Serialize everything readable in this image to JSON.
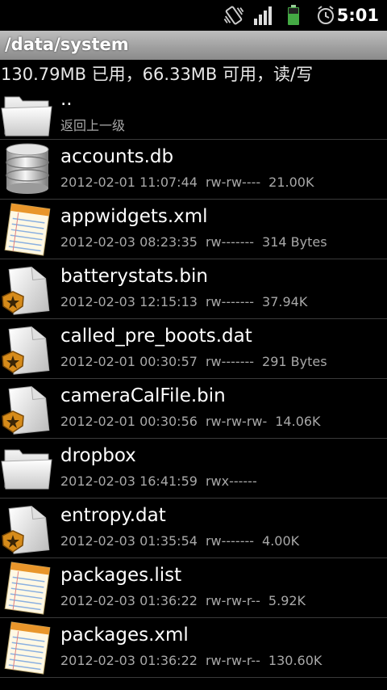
{
  "status_bar": {
    "time": "5:01",
    "icons": [
      "vibrate-icon",
      "signal-icon",
      "battery-icon",
      "alarm-icon"
    ]
  },
  "path": "/data/system",
  "storage_info": "130.79MB 已用，66.33MB 可用，读/写",
  "files": [
    {
      "name": "..",
      "meta": "返回上一级",
      "icon": "folder-icon"
    },
    {
      "name": "accounts.db",
      "date": "2012-02-01 11:07:44",
      "perm": "rw-rw----",
      "size": "21.00K",
      "icon": "database-icon"
    },
    {
      "name": "appwidgets.xml",
      "date": "2012-02-03 08:23:35",
      "perm": "rw-------",
      "size": "314 Bytes",
      "icon": "notepad-icon"
    },
    {
      "name": "batterystats.bin",
      "date": "2012-02-03 12:15:13",
      "perm": "rw-------",
      "size": "37.94K",
      "icon": "system-file-icon"
    },
    {
      "name": "called_pre_boots.dat",
      "date": "2012-02-01 00:30:57",
      "perm": "rw-------",
      "size": "291 Bytes",
      "icon": "system-file-icon"
    },
    {
      "name": "cameraCalFile.bin",
      "date": "2012-02-01 00:30:56",
      "perm": "rw-rw-rw-",
      "size": "14.06K",
      "icon": "system-file-icon"
    },
    {
      "name": "dropbox",
      "date": "2012-02-03 16:41:59",
      "perm": "rwx------",
      "size": "",
      "icon": "folder-icon"
    },
    {
      "name": "entropy.dat",
      "date": "2012-02-03 01:35:54",
      "perm": "rw-------",
      "size": "4.00K",
      "icon": "system-file-icon"
    },
    {
      "name": "packages.list",
      "date": "2012-02-03 01:36:22",
      "perm": "rw-rw-r--",
      "size": "5.92K",
      "icon": "notepad-icon"
    },
    {
      "name": "packages.xml",
      "date": "2012-02-03 01:36:22",
      "perm": "rw-rw-r--",
      "size": "130.60K",
      "icon": "notepad-icon"
    }
  ]
}
